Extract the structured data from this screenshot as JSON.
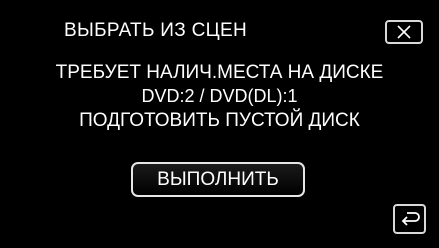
{
  "header": {
    "title": "ВЫБРАТЬ ИЗ СЦЕН",
    "close_icon": "close-icon"
  },
  "message": {
    "line1": "ТРЕБУЕТ НАЛИЧ.МЕСТА НА ДИСКЕ",
    "line2": "DVD:2 / DVD(DL):1",
    "line3": "ПОДГОТОВИТЬ ПУСТОЙ ДИСК"
  },
  "actions": {
    "execute_label": "ВЫПОЛНИТЬ",
    "back_icon": "return-arrow-icon"
  },
  "colors": {
    "background": "#000000",
    "text": "#ffffff",
    "button_border": "#e6e6e6"
  }
}
